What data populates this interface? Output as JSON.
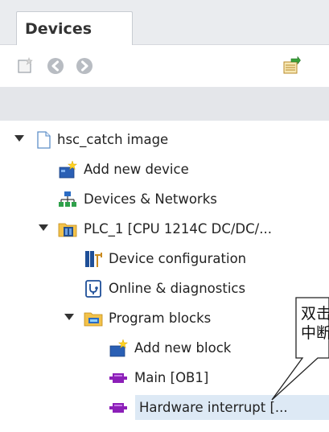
{
  "panel": {
    "tab_label": "Devices"
  },
  "toolbar": {
    "buttons": [
      "new-item-icon",
      "back-icon",
      "forward-icon",
      "export-icon"
    ]
  },
  "tree": {
    "project": "hsc_catch image",
    "add_device": "Add new device",
    "devices_networks": "Devices & Networks",
    "plc": "PLC_1 [CPU 1214C DC/DC/...",
    "device_config": "Device configuration",
    "online_diag": "Online & diagnostics",
    "program_blocks": "Program blocks",
    "add_block": "Add new block",
    "main": "Main [OB1]",
    "hw_interrupt": "Hardware interrupt [..."
  },
  "callout": {
    "line1": "双击",
    "line2": "中断"
  }
}
